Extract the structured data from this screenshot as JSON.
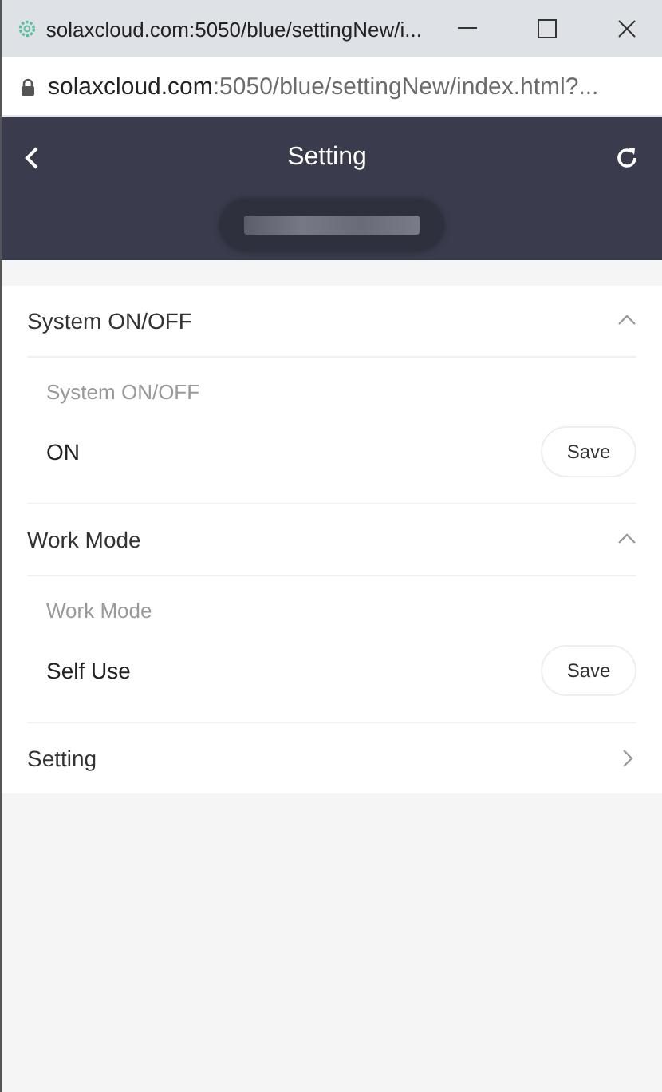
{
  "window": {
    "title": "solaxcloud.com:5050/blue/settingNew/i..."
  },
  "address_bar": {
    "url": "**solaxcloud.com**:5050/blue/settingNew/index.html?..."
  },
  "header": {
    "title": "Setting"
  },
  "sections": [
    {
      "title": "System ON/OFF",
      "expanded": true,
      "field_label": "System ON/OFF",
      "value": "ON",
      "button": "Save"
    },
    {
      "title": "Work Mode",
      "expanded": true,
      "field_label": "Work Mode",
      "value": "Self Use",
      "button": "Save"
    },
    {
      "title": "Setting",
      "expanded": false
    }
  ]
}
